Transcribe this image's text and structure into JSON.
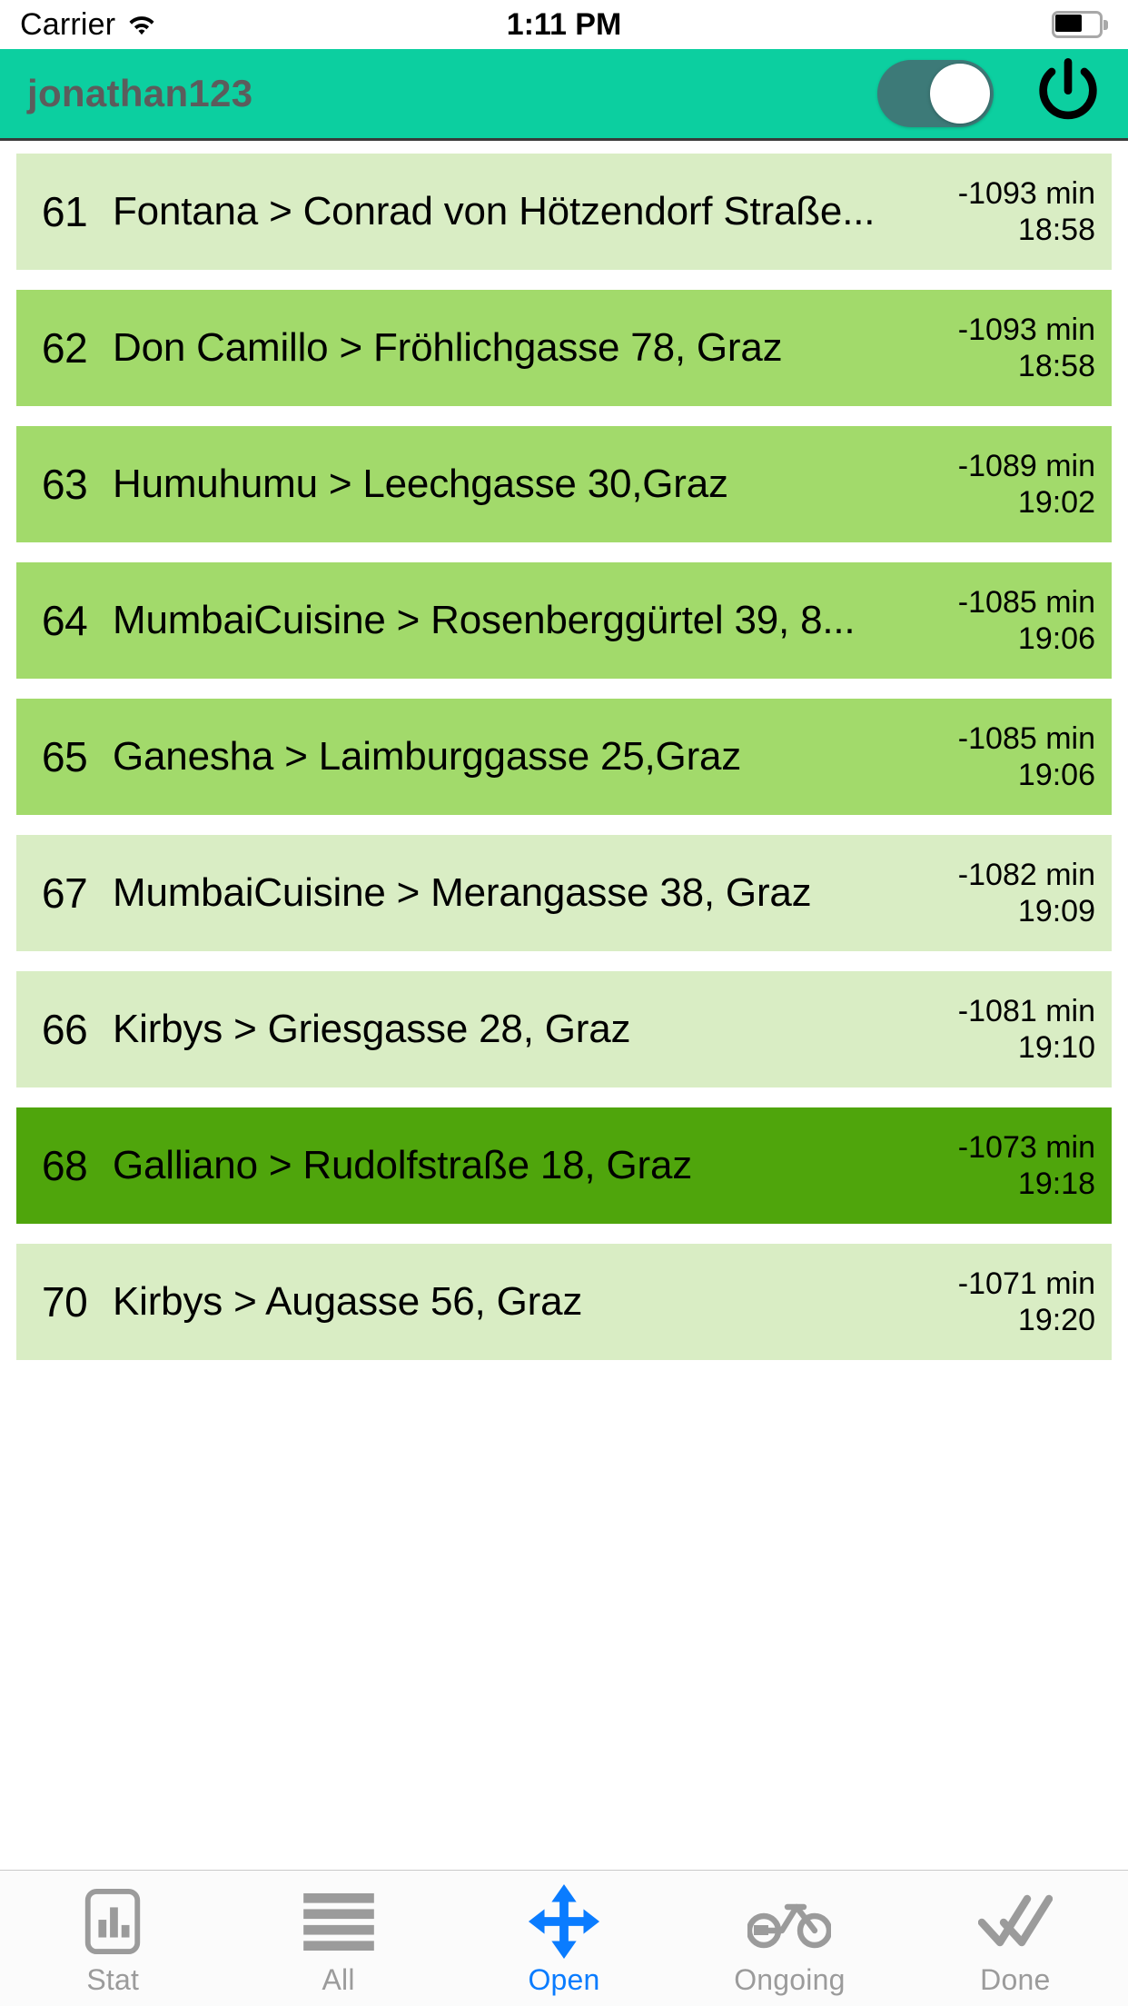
{
  "status_bar": {
    "carrier": "Carrier",
    "wifi_icon": "wifi-icon",
    "time": "1:11 PM",
    "battery_icon": "battery-icon"
  },
  "header": {
    "username": "jonathan123",
    "toggle": {
      "name": "availability-toggle",
      "state": "on",
      "track_color": "#3d7a78",
      "knob_color": "#ffffff"
    },
    "power_icon": "power-icon",
    "background_color": "#0ccfa0"
  },
  "colors": {
    "row_light": "#d9edc4",
    "row_medium": "#a2da6b",
    "row_dark": "#4fa50c",
    "accent_blue": "#0a7cff",
    "tab_inactive": "#9b9b9b"
  },
  "orders": [
    {
      "id": "61",
      "title": "Fontana > Conrad von Hötzendorf Straße...",
      "eta": "-1093 min",
      "time": "18:58",
      "shade": "light"
    },
    {
      "id": "62",
      "title": "Don Camillo > Fröhlichgasse 78, Graz",
      "eta": "-1093 min",
      "time": "18:58",
      "shade": "medium"
    },
    {
      "id": "63",
      "title": "Humuhumu > Leechgasse 30,Graz",
      "eta": "-1089 min",
      "time": "19:02",
      "shade": "medium"
    },
    {
      "id": "64",
      "title": "MumbaiCuisine > Rosenberggürtel 39, 8...",
      "eta": "-1085 min",
      "time": "19:06",
      "shade": "medium"
    },
    {
      "id": "65",
      "title": "Ganesha > Laimburggasse 25,Graz",
      "eta": "-1085 min",
      "time": "19:06",
      "shade": "medium"
    },
    {
      "id": "67",
      "title": "MumbaiCuisine > Merangasse 38, Graz",
      "eta": "-1082 min",
      "time": "19:09",
      "shade": "light"
    },
    {
      "id": "66",
      "title": "Kirbys > Griesgasse 28, Graz",
      "eta": "-1081 min",
      "time": "19:10",
      "shade": "light"
    },
    {
      "id": "68",
      "title": "Galliano > Rudolfstraße 18, Graz",
      "eta": "-1073 min",
      "time": "19:18",
      "shade": "dark"
    },
    {
      "id": "70",
      "title": "Kirbys > Augasse 56, Graz",
      "eta": "-1071 min",
      "time": "19:20",
      "shade": "light"
    }
  ],
  "tabs": [
    {
      "label": "Stat",
      "icon": "chart-phone-icon",
      "active": false
    },
    {
      "label": "All",
      "icon": "list-lines-icon",
      "active": false
    },
    {
      "label": "Open",
      "icon": "four-way-arrows-icon",
      "active": true
    },
    {
      "label": "Ongoing",
      "icon": "bicycle-icon",
      "active": false
    },
    {
      "label": "Done",
      "icon": "double-check-icon",
      "active": false
    }
  ]
}
